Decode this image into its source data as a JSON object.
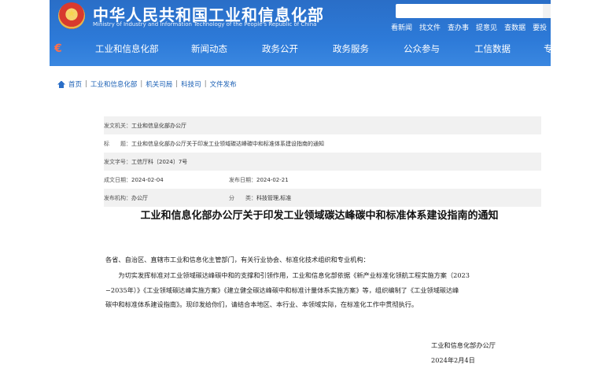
{
  "header": {
    "site_title": "中华人民共和国工业和信息化部",
    "site_subtitle": "Ministry of Industry and Information Technology of the People's Republic of China",
    "quick_links": [
      "看新闻",
      "找文件",
      "查办事",
      "提意见",
      "查数据",
      "要投"
    ],
    "nav_items": [
      "工业和信息化部",
      "新闻动态",
      "政务公开",
      "政务服务",
      "公众参与",
      "工信数据",
      "专"
    ]
  },
  "breadcrumb": {
    "items": [
      "首页",
      "工业和信息化部",
      "机关司局",
      "科技司",
      "文件发布"
    ],
    "separator": "|"
  },
  "meta": {
    "issuer_label": "发文机关：",
    "issuer": "工业和信息化部办公厅",
    "title_label": "标　　题：",
    "title": "工业和信息化部办公厅关于印发工业领域碳达峰碳中和标准体系建设指南的通知",
    "doc_no_label": "发文字号：",
    "doc_no": "工信厅科〔2024〕7号",
    "created_label": "成文日期：",
    "created": "2024-02-04",
    "published_label": "发布日期：",
    "published": "2024-02-21",
    "org_label": "发布机构：",
    "org": "办公厅",
    "category_label": "分　　类：",
    "category": "科技管理,标准"
  },
  "article": {
    "title": "工业和信息化部办公厅关于印发工业领域碳达峰碳中和标准体系建设指南的通知",
    "paragraphs": [
      "各省、自治区、直辖市工业和信息化主管部门，有关行业协会、标准化技术组织和专业机构：",
      "　　为切实发挥标准对工业领域碳达峰碳中和的支撑和引领作用，工业和信息化部依据《新产业标准化领航工程实施方案（2023",
      "−2035年）》《工业领域碳达峰实施方案》《建立健全碳达峰碳中和标准计量体系实施方案》等，组织编制了《工业领域碳达峰",
      "碳中和标准体系建设指南》。现印发给你们，请结合本地区、本行业、本领域实际，在标准化工作中贯彻执行。"
    ],
    "signature": "工业和信息化部办公厅",
    "date": "2024年2月4日"
  }
}
